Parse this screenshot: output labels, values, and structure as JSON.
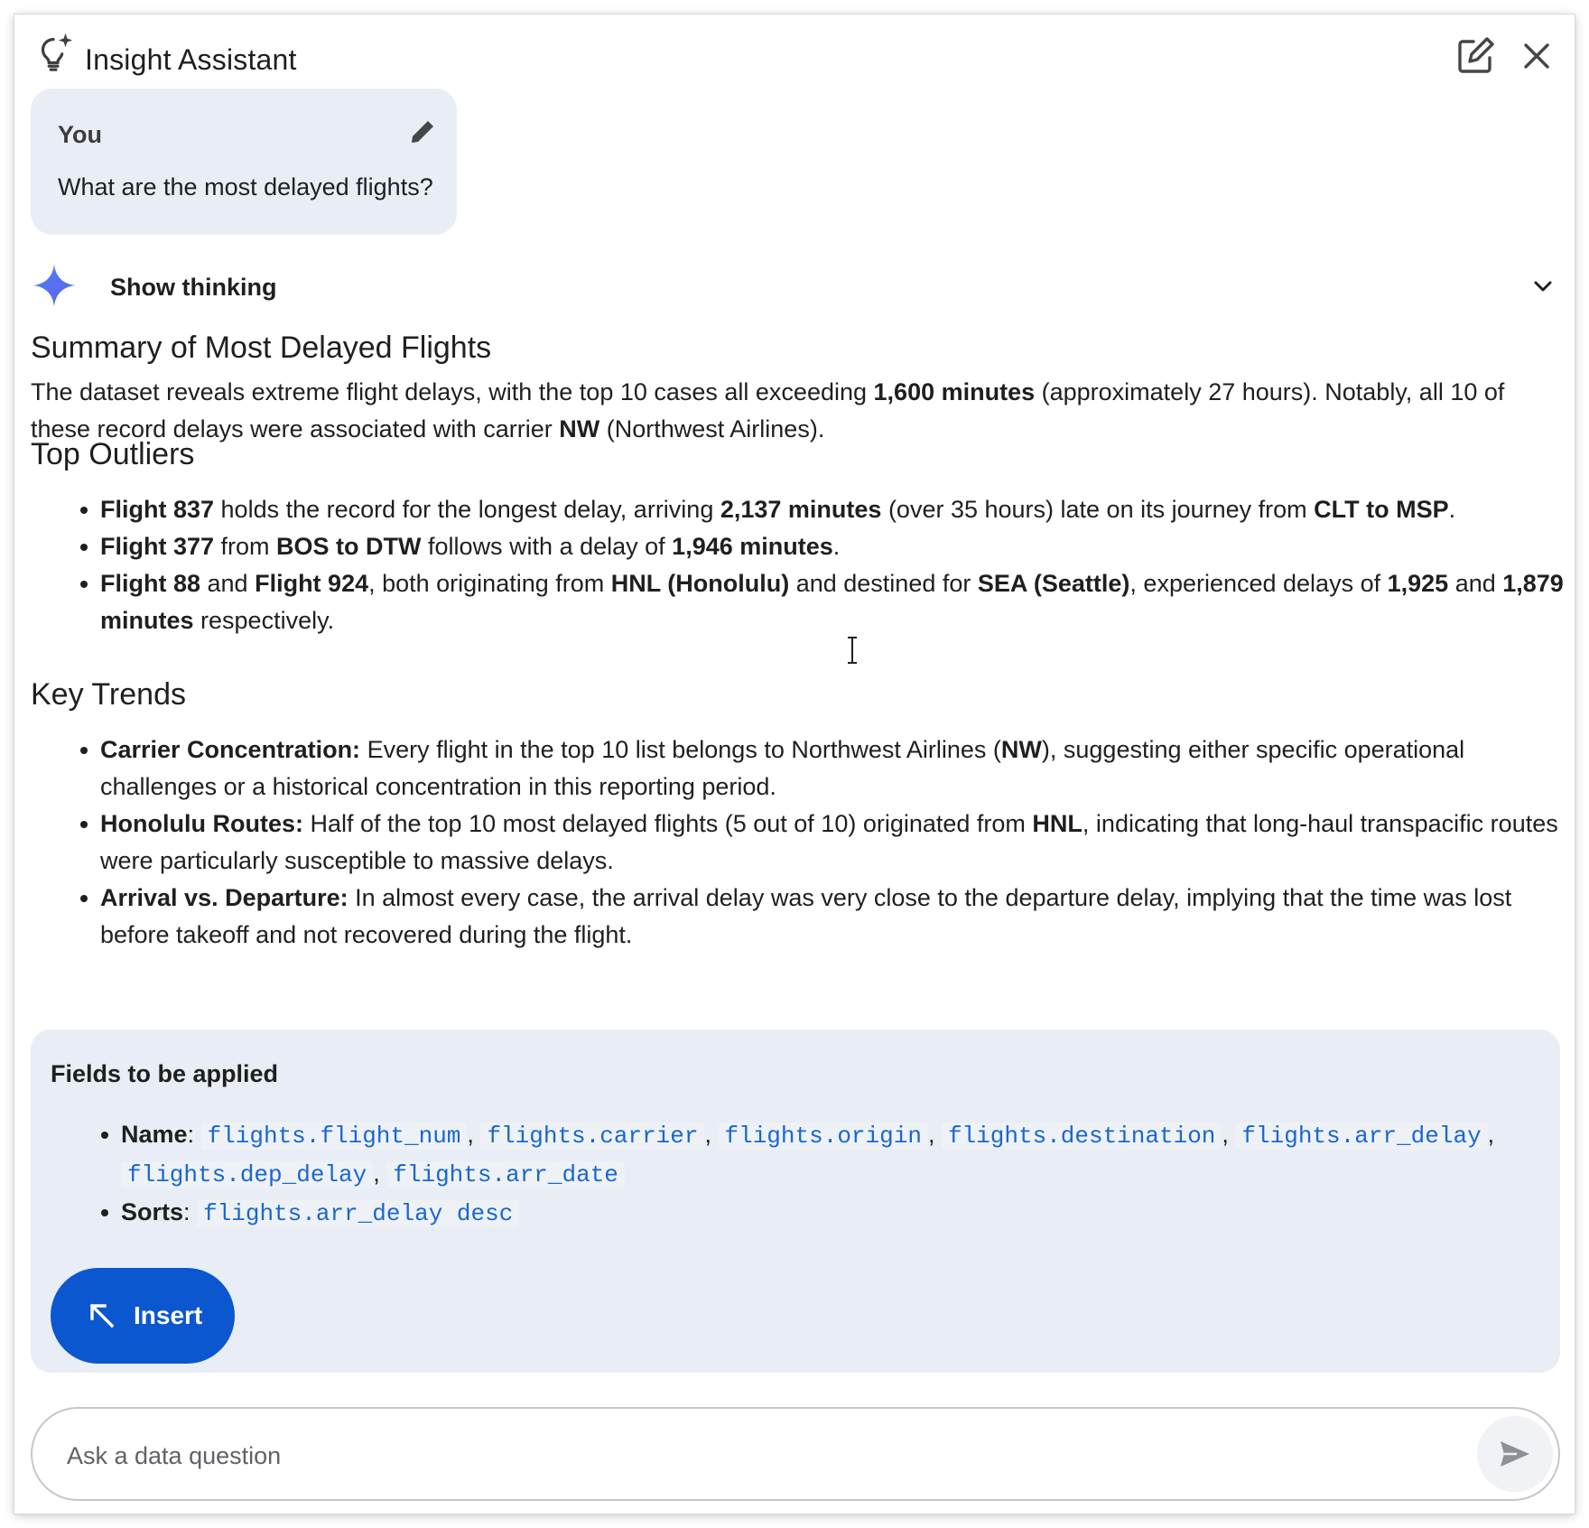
{
  "header": {
    "title": "Insight Assistant",
    "icons": {
      "app": "lightbulb-sparkle-icon",
      "edit": "edit-new-chat-icon",
      "close": "close-icon"
    }
  },
  "user_message": {
    "author": "You",
    "text": "What are the most delayed flights?"
  },
  "thinking": {
    "label": "Show thinking"
  },
  "response": {
    "summary_heading": "Summary of Most Delayed Flights",
    "summary": {
      "t1": "The dataset reveals extreme flight delays, with the top 10 cases all exceeding ",
      "b1": "1,600 minutes",
      "t2": " (approximately 27 hours). Notably, all 10 of these record delays were associated with carrier ",
      "b2": "NW",
      "t3": " (Northwest Airlines)."
    },
    "outliers_heading": "Top Outliers",
    "outliers": [
      {
        "b1": "Flight 837",
        "t1": " holds the record for the longest delay, arriving ",
        "b2": "2,137 minutes",
        "t2": " (over 35 hours) late on its journey from ",
        "b3": "CLT to MSP",
        "t3": "."
      },
      {
        "b1": "Flight 377",
        "t1": " from ",
        "b2": "BOS to DTW",
        "t2": " follows with a delay of ",
        "b3": "1,946 minutes",
        "t3": "."
      },
      {
        "b1": "Flight 88",
        "t1": " and ",
        "b2": "Flight 924",
        "t2": ", both originating from ",
        "b3": "HNL (Honolulu)",
        "t3": " and destined for ",
        "b4": "SEA (Seattle)",
        "t4": ", experienced delays of ",
        "b5": "1,925",
        "t5": " and ",
        "b6": "1,879 minutes",
        "t6": " respectively."
      }
    ],
    "trends_heading": "Key Trends",
    "trends": [
      {
        "b1": "Carrier Concentration:",
        "t1": " Every flight in the top 10 list belongs to Northwest Airlines (",
        "b2": "NW",
        "t2": "), suggesting either specific operational challenges or a historical concentration in this reporting period."
      },
      {
        "b1": "Honolulu Routes:",
        "t1": " Half of the top 10 most delayed flights (5 out of 10) originated from ",
        "b2": "HNL",
        "t2": ", indicating that long-haul transpacific routes were particularly susceptible to massive delays."
      },
      {
        "b1": "Arrival vs. Departure:",
        "t1": " In almost every case, the arrival delay was very close to the departure delay, implying that the time was lost before takeoff and not recovered during the flight."
      }
    ]
  },
  "fields_card": {
    "title": "Fields to be applied",
    "name_label": "Name",
    "names": [
      "flights.flight_num",
      "flights.carrier",
      "flights.origin",
      "flights.destination",
      "flights.arr_delay",
      "flights.dep_delay",
      "flights.arr_date"
    ],
    "sorts_label": "Sorts",
    "sorts": [
      "flights.arr_delay desc"
    ],
    "insert_label": "Insert"
  },
  "input": {
    "placeholder": "Ask a data question",
    "value": ""
  },
  "colors": {
    "accent": "#0b57d0",
    "card_bg": "#e9eef6",
    "code_text": "#1a66d2"
  }
}
